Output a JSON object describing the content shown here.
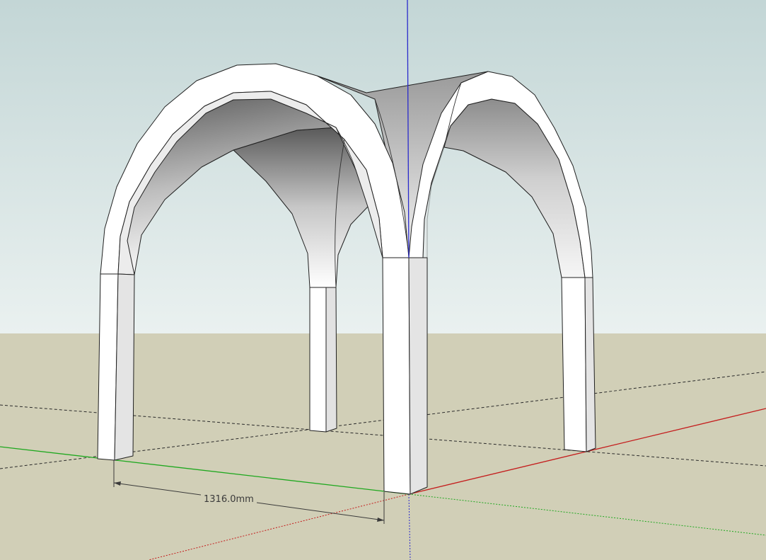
{
  "scene": {
    "model": "groin-vault",
    "dimension": {
      "value": "1316.0mm"
    }
  },
  "colors": {
    "sky_top": "#c3d6d6",
    "sky_bottom": "#eaf1f0",
    "ground": "#d1cfb7",
    "face_front": "#ffffff",
    "face_side": "#e4e4e4",
    "edge": "#202020",
    "axis_red": "#c41c1c",
    "axis_green": "#1fa81f",
    "axis_blue": "#2a2acc",
    "guide": "#2a2a2a"
  }
}
